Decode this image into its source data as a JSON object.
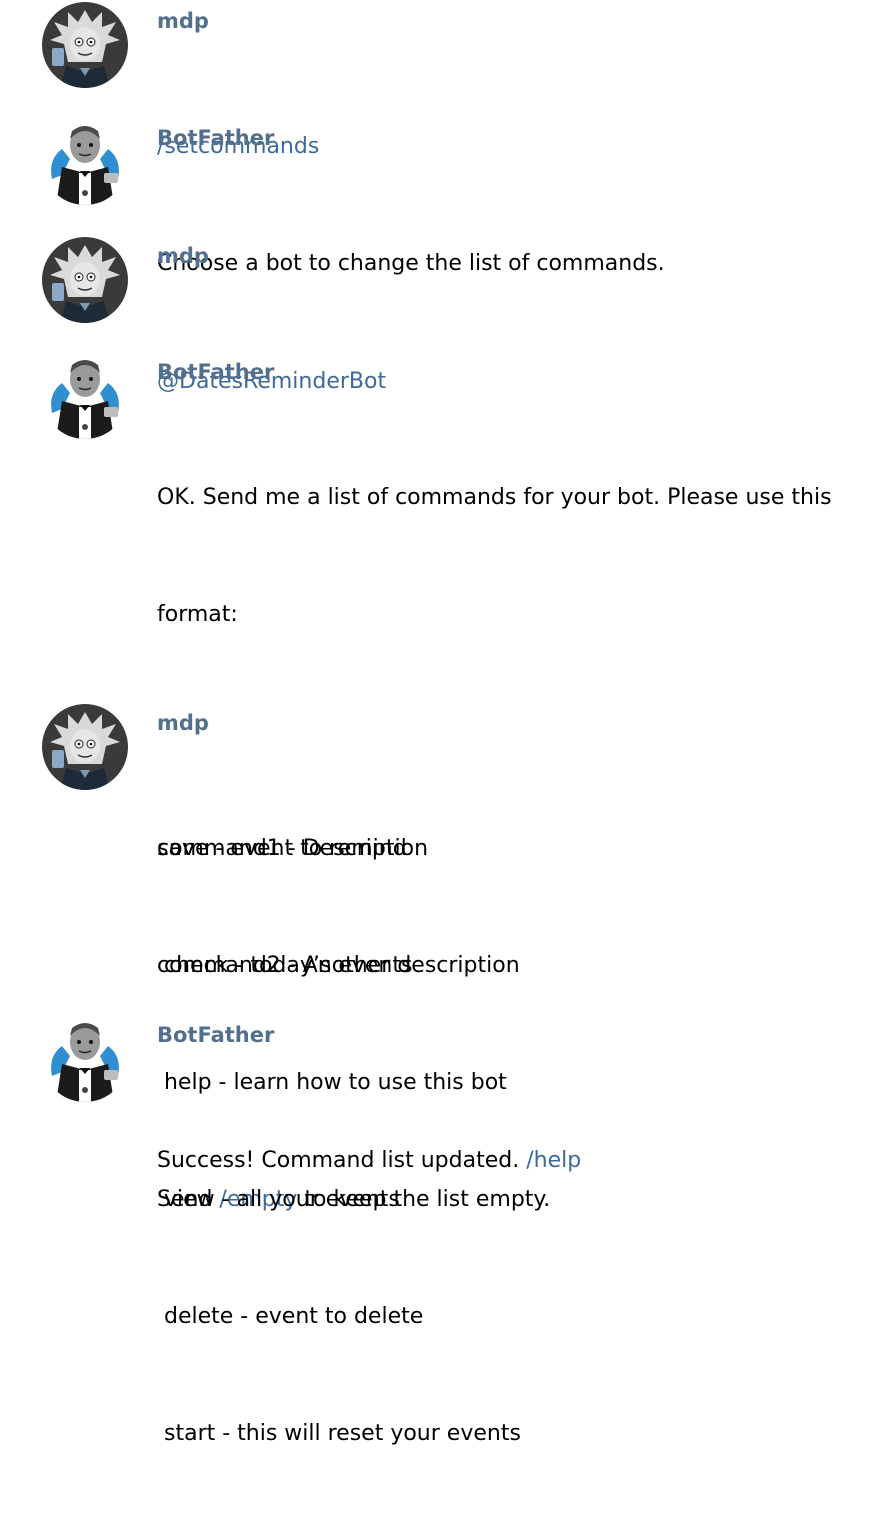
{
  "conversation": {
    "messages": [
      {
        "author": "mdp",
        "avatar_icon": "rick-avatar-icon",
        "lines": [
          [
            {
              "text": "/setcommands",
              "link": true
            }
          ]
        ]
      },
      {
        "author": "BotFather",
        "avatar_icon": "botfather-avatar-icon",
        "lines": [
          [
            {
              "text": "Choose a bot to change the list of commands.",
              "link": false
            }
          ]
        ]
      },
      {
        "author": "mdp",
        "avatar_icon": "rick-avatar-icon",
        "lines": [
          [
            {
              "text": "@DatesReminderBot",
              "link": true
            }
          ]
        ]
      },
      {
        "author": "BotFather",
        "avatar_icon": "botfather-avatar-icon",
        "lines": [
          [
            {
              "text": "OK. Send me a list of commands for your bot. Please use this",
              "link": false
            }
          ],
          [
            {
              "text": "format:",
              "link": false
            }
          ],
          [],
          [
            {
              "text": "command1 - Description",
              "link": false
            }
          ],
          [
            {
              "text": "command2 - Another description",
              "link": false
            }
          ],
          [],
          [
            {
              "text": "Send ",
              "link": false
            },
            {
              "text": "/empty",
              "link": true
            },
            {
              "text": " to keep the list empty.",
              "link": false
            }
          ]
        ]
      },
      {
        "author": "mdp",
        "avatar_icon": "rick-avatar-icon",
        "lines": [
          [
            {
              "text": "save - event to remind",
              "link": false
            }
          ],
          [
            {
              "text": " check - today’s events",
              "link": false
            }
          ],
          [
            {
              "text": " help - learn how to use this bot",
              "link": false
            }
          ],
          [
            {
              "text": " view - all your events",
              "link": false
            }
          ],
          [
            {
              "text": " delete - event to delete",
              "link": false
            }
          ],
          [
            {
              "text": " start - this will reset your events",
              "link": false
            }
          ]
        ]
      },
      {
        "author": "BotFather",
        "avatar_icon": "botfather-avatar-icon",
        "lines": [
          [
            {
              "text": "Success! Command list updated. ",
              "link": false
            },
            {
              "text": "/help",
              "link": true
            }
          ]
        ]
      }
    ]
  },
  "colors": {
    "author": "#52708e",
    "link": "#3d6a99",
    "text": "#000000",
    "background": "#ffffff"
  }
}
